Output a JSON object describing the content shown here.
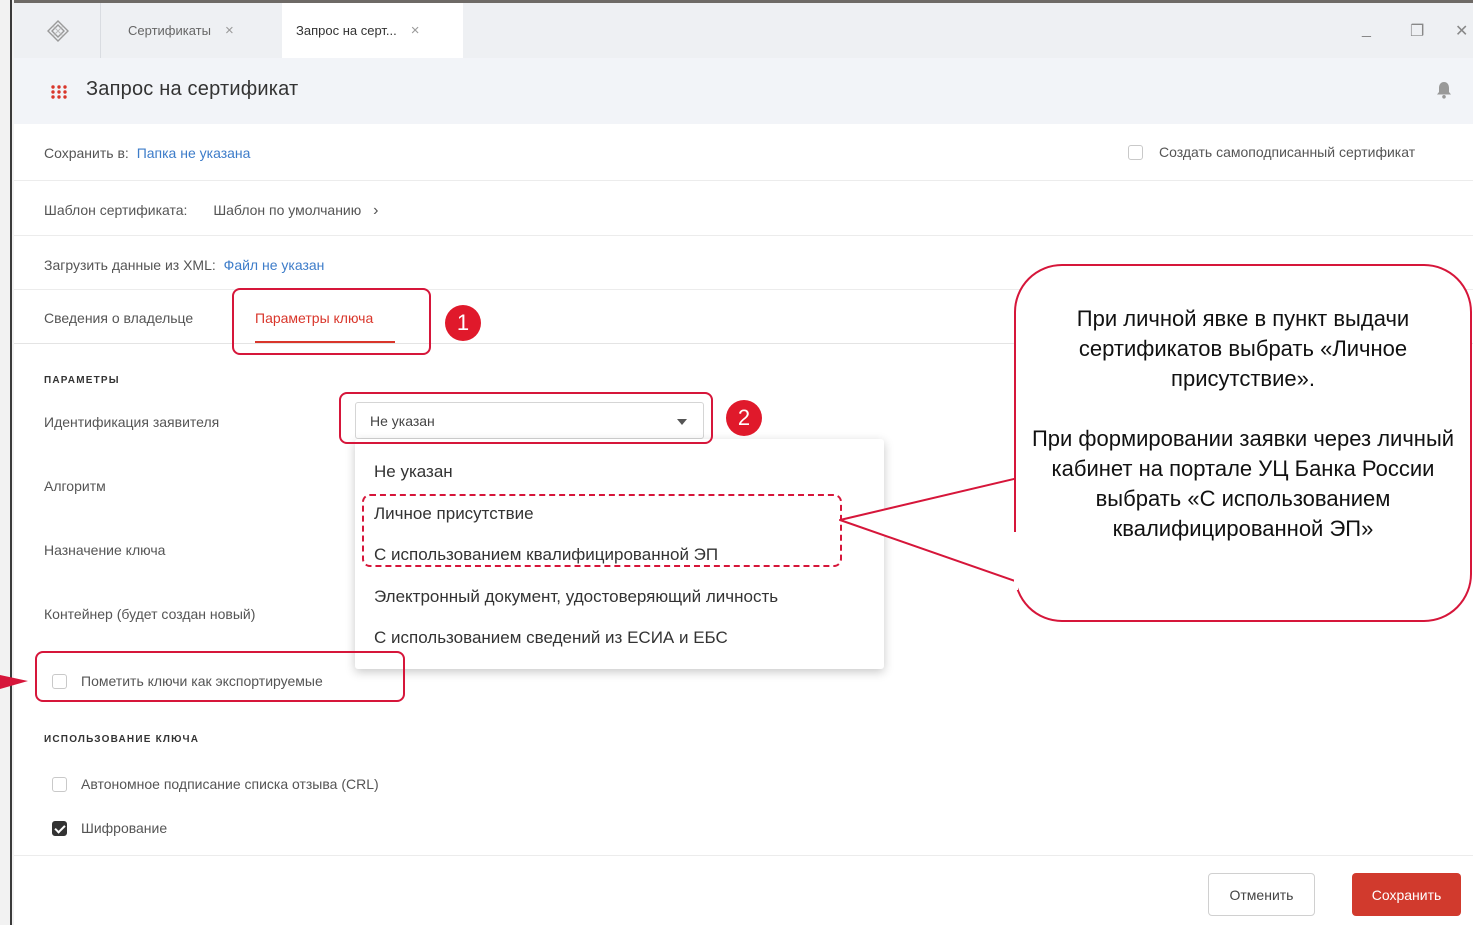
{
  "tabs": [
    {
      "label": "Сертификаты"
    },
    {
      "label": "Запрос на серт..."
    }
  ],
  "window_controls": {
    "minimize": "_",
    "restore": "❐",
    "close": "✕"
  },
  "header": {
    "title": "Запрос на сертификат"
  },
  "save_to": {
    "label": "Сохранить в:",
    "value": "Папка не указана"
  },
  "self_signed": {
    "label": "Создать самоподписанный сертификат",
    "checked": false
  },
  "template": {
    "label": "Шаблон сертификата:",
    "value": "Шаблон по умолчанию",
    "chevron": "›"
  },
  "xml": {
    "label": "Загрузить данные из XML:",
    "value": "Файл не указан"
  },
  "inner_tabs": [
    {
      "label": "Сведения о владельце",
      "active": false
    },
    {
      "label": "Параметры ключа",
      "active": true
    }
  ],
  "params": {
    "section_title": "ПАРАМЕТРЫ",
    "identification_label": "Идентификация заявителя",
    "identification_value": "Не указан",
    "algorithm_label": "Алгоритм",
    "key_purpose_label": "Назначение ключа",
    "container_label": "Контейнер (будет создан новый)",
    "exportable_label": "Пометить ключи как экспортируемые",
    "exportable_checked": false
  },
  "dropdown_options": [
    "Не указан",
    "Личное присутствие",
    "С использованием квалифицированной ЭП",
    "Электронный документ, удостоверяющий личность",
    "С использованием сведений из ЕСИА и ЕБС"
  ],
  "key_usage": {
    "section_title": "ИСПОЛЬЗОВАНИЕ КЛЮЧА",
    "crl_label": "Автономное подписание списка отзыва (CRL)",
    "crl_checked": false,
    "encryption_label": "Шифрование",
    "encryption_checked": true
  },
  "footer": {
    "cancel": "Отменить",
    "save": "Сохранить"
  },
  "annotations": {
    "badge_1": "1",
    "badge_2": "2",
    "callout_line1": "При личной явке в пункт выдачи сертификатов выбрать «Личное присутствие».",
    "callout_line2": "При формировании заявки через личный кабинет на портале УЦ Банка России выбрать «С использованием квалифицированной ЭП»"
  },
  "colors": {
    "accent": "#d9362b",
    "link": "#3d7cc9",
    "annotation": "#d6163a"
  }
}
